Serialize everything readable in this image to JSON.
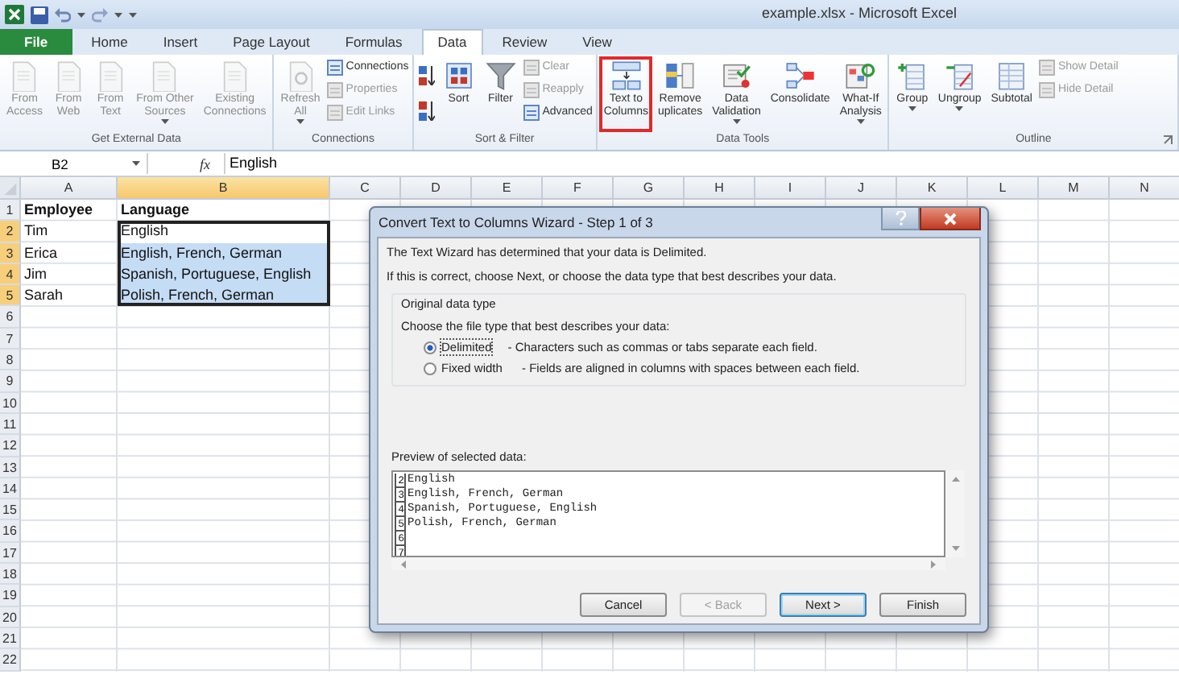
{
  "window": {
    "title": "example.xlsx - Microsoft Excel"
  },
  "tabs": [
    {
      "label": "File",
      "kind": "file",
      "selected": false
    },
    {
      "label": "Home",
      "kind": "tab",
      "selected": false
    },
    {
      "label": "Insert",
      "kind": "tab",
      "selected": false
    },
    {
      "label": "Page Layout",
      "kind": "tab",
      "selected": false
    },
    {
      "label": "Formulas",
      "kind": "tab",
      "selected": false
    },
    {
      "label": "Data",
      "kind": "tab",
      "selected": true
    },
    {
      "label": "Review",
      "kind": "tab",
      "selected": false
    },
    {
      "label": "View",
      "kind": "tab",
      "selected": false
    }
  ],
  "ribbon": [
    {
      "label": "Get External Data",
      "items": [
        {
          "kind": "large",
          "label": "From\nAccess",
          "disabled": true
        },
        {
          "kind": "large",
          "label": "From\nWeb",
          "disabled": true
        },
        {
          "kind": "large",
          "label": "From\nText",
          "disabled": true
        },
        {
          "kind": "large",
          "label": "From Other\nSources",
          "disabled": true,
          "dropdown": true
        },
        {
          "kind": "large",
          "label": "Existing\nConnections",
          "disabled": true
        }
      ]
    },
    {
      "label": "Connections",
      "items": [
        {
          "kind": "large",
          "label": "Refresh\nAll",
          "disabled": true,
          "dropdown": true
        },
        {
          "kind": "small",
          "label": "Connections",
          "disabled": false
        },
        {
          "kind": "small",
          "label": "Properties",
          "disabled": true
        },
        {
          "kind": "small",
          "label": "Edit Links",
          "disabled": true
        }
      ]
    },
    {
      "label": "Sort & Filter",
      "items": [
        {
          "kind": "icon"
        },
        {
          "kind": "icon"
        },
        {
          "kind": "large",
          "label": "Sort",
          "disabled": false
        },
        {
          "kind": "large",
          "label": "Filter",
          "disabled": false
        },
        {
          "kind": "small",
          "label": "Clear",
          "disabled": true
        },
        {
          "kind": "small",
          "label": "Reapply",
          "disabled": true
        },
        {
          "kind": "small",
          "label": "Advanced",
          "disabled": false
        }
      ]
    },
    {
      "label": "Data Tools",
      "items": [
        {
          "kind": "large",
          "label": "Text to\nColumns",
          "disabled": false,
          "highlighted": true
        },
        {
          "kind": "large",
          "label": "Remove\nuplicates",
          "disabled": false
        },
        {
          "kind": "large",
          "label": "Data\nValidation",
          "disabled": false,
          "dropdown": true
        },
        {
          "kind": "large",
          "label": "Consolidate",
          "disabled": false
        },
        {
          "kind": "large",
          "label": "What-If\nAnalysis",
          "disabled": false,
          "dropdown": true
        }
      ]
    },
    {
      "label": "Outline",
      "items": [
        {
          "kind": "large",
          "label": "Group",
          "disabled": false,
          "dropdown": true
        },
        {
          "kind": "large",
          "label": "Ungroup",
          "disabled": false,
          "dropdown": true
        },
        {
          "kind": "large",
          "label": "Subtotal",
          "disabled": false
        },
        {
          "kind": "small",
          "label": "Show Detail",
          "disabled": true
        },
        {
          "kind": "small",
          "label": "Hide Detail",
          "disabled": true
        }
      ]
    }
  ],
  "formula_bar": {
    "name_box": "B2",
    "function_label": "fx",
    "value": "English"
  },
  "sheet": {
    "columns": [
      {
        "label": "A",
        "selected": false
      },
      {
        "label": "B",
        "selected": true
      },
      {
        "label": "C",
        "selected": false
      },
      {
        "label": "D",
        "selected": false
      },
      {
        "label": "E",
        "selected": false
      },
      {
        "label": "F",
        "selected": false
      },
      {
        "label": "G",
        "selected": false
      },
      {
        "label": "H",
        "selected": false
      },
      {
        "label": "I",
        "selected": false
      },
      {
        "label": "J",
        "selected": false
      },
      {
        "label": "K",
        "selected": false
      },
      {
        "label": "L",
        "selected": false
      },
      {
        "label": "M",
        "selected": false
      },
      {
        "label": "N",
        "selected": false
      }
    ],
    "rows": [
      {
        "number": "1",
        "selected": false,
        "cells": [
          {
            "text": "Employee",
            "selected": false
          },
          {
            "text": "Language",
            "selected": false
          }
        ]
      },
      {
        "number": "2",
        "selected": true,
        "cells": [
          {
            "text": "Tim",
            "selected": false
          },
          {
            "text": "English",
            "selected": true
          }
        ]
      },
      {
        "number": "3",
        "selected": true,
        "cells": [
          {
            "text": "Erica",
            "selected": false
          },
          {
            "text": "English, French, German",
            "selected": true
          }
        ]
      },
      {
        "number": "4",
        "selected": true,
        "cells": [
          {
            "text": "Jim",
            "selected": false
          },
          {
            "text": "Spanish, Portuguese, English",
            "selected": true
          }
        ]
      },
      {
        "number": "5",
        "selected": true,
        "cells": [
          {
            "text": "Sarah",
            "selected": false
          },
          {
            "text": "Polish, French, German",
            "selected": true
          }
        ]
      },
      {
        "number": "6",
        "selected": false
      },
      {
        "number": "7",
        "selected": false
      },
      {
        "number": "8",
        "selected": false
      },
      {
        "number": "9",
        "selected": false
      },
      {
        "number": "10",
        "selected": false
      },
      {
        "number": "11",
        "selected": false
      },
      {
        "number": "12",
        "selected": false
      },
      {
        "number": "13",
        "selected": false
      },
      {
        "number": "14",
        "selected": false
      },
      {
        "number": "15",
        "selected": false
      },
      {
        "number": "16",
        "selected": false
      },
      {
        "number": "17",
        "selected": false
      },
      {
        "number": "18",
        "selected": false
      },
      {
        "number": "19",
        "selected": false
      },
      {
        "number": "20",
        "selected": false
      },
      {
        "number": "21",
        "selected": false
      },
      {
        "number": "22",
        "selected": false
      }
    ]
  },
  "dialog": {
    "title": "Convert Text to Columns Wizard - Step 1 of 3",
    "intro": [
      "The Text Wizard has determined that your data is Delimited.",
      "If this is correct, choose Next, or choose the data type that best describes your data."
    ],
    "group_label": "Original data type",
    "prompt": "Choose the file type that best describes your data:",
    "options": [
      {
        "label": "Delimited",
        "description": "- Characters such as commas or tabs separate each field.",
        "selected": true
      },
      {
        "label": "Fixed width",
        "description": "- Fields are aligned in columns with spaces between each field.",
        "selected": false
      }
    ],
    "preview_label": "Preview of selected data:",
    "preview_rows": [
      {
        "number": "2",
        "text": "English"
      },
      {
        "number": "3",
        "text": "English, French, German"
      },
      {
        "number": "4",
        "text": "Spanish, Portuguese, English"
      },
      {
        "number": "5",
        "text": "Polish, French, German"
      },
      {
        "number": "6"
      },
      {
        "number": "7"
      }
    ],
    "buttons": [
      {
        "label": "Cancel",
        "disabled": false,
        "default": false
      },
      {
        "label": "< Back",
        "disabled": true,
        "default": false
      },
      {
        "label": "Next >",
        "disabled": false,
        "default": true
      },
      {
        "label": "Finish",
        "disabled": false,
        "default": false
      }
    ]
  }
}
